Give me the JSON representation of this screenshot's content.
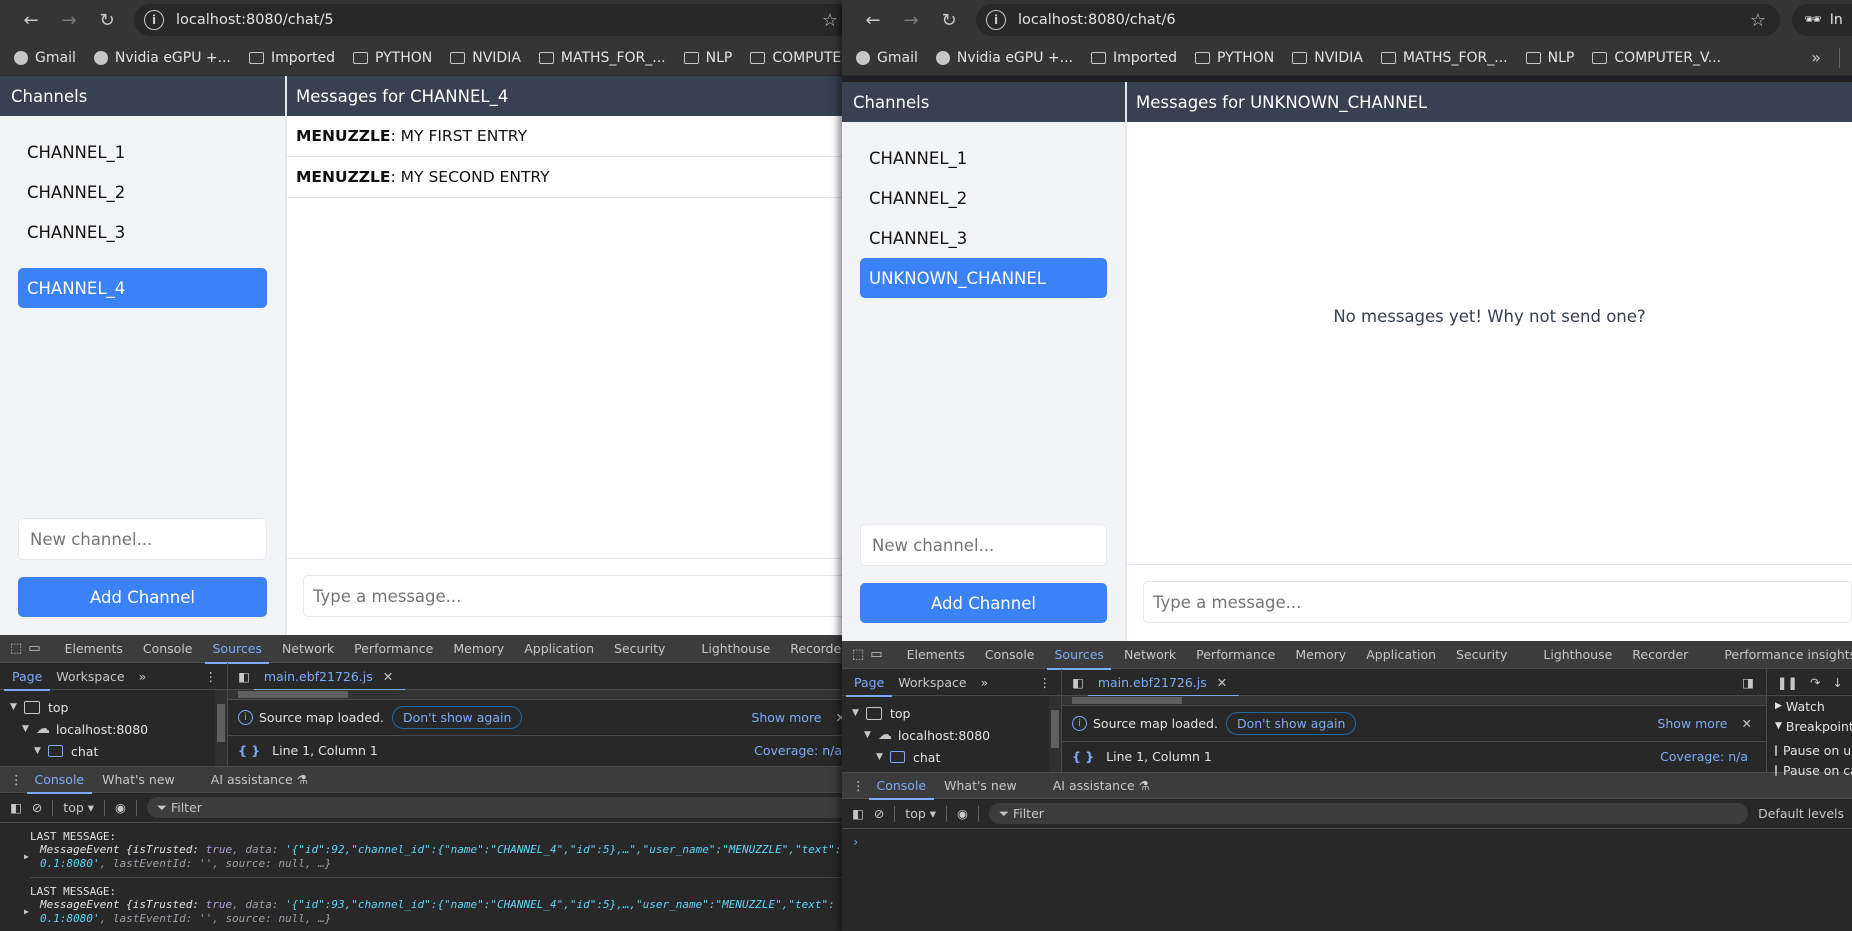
{
  "windows": [
    {
      "url": "localhost:8080/chat/5",
      "bookmarks": [
        "Gmail",
        "Nvidia eGPU +...",
        "Imported",
        "PYTHON",
        "NVIDIA",
        "MATHS_FOR_...",
        "NLP",
        "COMPUTER_V..."
      ],
      "app": {
        "sidebar_title": "Channels",
        "channels": [
          "CHANNEL_1",
          "CHANNEL_2",
          "CHANNEL_3",
          "CHANNEL_4"
        ],
        "active_channel": "CHANNEL_4",
        "new_channel_placeholder": "New channel...",
        "add_channel_label": "Add Channel",
        "messages_title": "Messages for CHANNEL_4",
        "messages": [
          {
            "user": "MENUZZLE",
            "text": "MY FIRST ENTRY"
          },
          {
            "user": "MENUZZLE",
            "text": "MY SECOND ENTRY"
          }
        ],
        "empty_text": "",
        "message_placeholder": "Type a message..."
      },
      "devtools": {
        "tabs": [
          "Elements",
          "Console",
          "Sources",
          "Network",
          "Performance",
          "Memory",
          "Application",
          "Security",
          "Lighthouse",
          "Recorder"
        ],
        "active_tab": "Sources",
        "nav_tabs": [
          "Page",
          "Workspace"
        ],
        "tree": [
          "top",
          "localhost:8080",
          "chat"
        ],
        "file_tab": "main.ebf21726.js",
        "info_text": "Source map loaded.",
        "dont_show": "Don't show again",
        "show_more": "Show more",
        "status_position": "Line 1, Column 1",
        "coverage": "Coverage: n/a",
        "drawer_tabs": [
          "Console",
          "What's new",
          "AI assistance"
        ],
        "context": "top",
        "filter_placeholder": "Filter",
        "logs": [
          {
            "label": "LAST MESSAGE:",
            "line1_pre": "MessageEvent {isTrusted: ",
            "line1_true": "true",
            "line1_mid": ", data: ",
            "line1_str": "'{\"id\":92,\"channel_id\":{\"name\":\"CHANNEL_4\",\"id\":5},…\",\"user_name\":\"MENUZZLE\",\"text\":",
            "line2_str": "0.1:8080'",
            "line2_rest": ", lastEventId: '', source: null, …}"
          },
          {
            "label": "LAST MESSAGE:",
            "line1_pre": "MessageEvent {isTrusted: ",
            "line1_true": "true",
            "line1_mid": ", data: ",
            "line1_str": "'{\"id\":93,\"channel_id\":{\"name\":\"CHANNEL_4\",\"id\":5},…,\"user_name\":\"MENUZZLE\",\"text\":",
            "line2_str": "0.1:8080'",
            "line2_rest": ", lastEventId: '', source: null, …}"
          }
        ]
      }
    },
    {
      "url": "localhost:8080/chat/6",
      "profile_label": "In",
      "bookmarks": [
        "Gmail",
        "Nvidia eGPU +...",
        "Imported",
        "PYTHON",
        "NVIDIA",
        "MATHS_FOR_...",
        "NLP",
        "COMPUTER_V..."
      ],
      "app": {
        "sidebar_title": "Channels",
        "channels": [
          "CHANNEL_1",
          "CHANNEL_2",
          "CHANNEL_3",
          "UNKNOWN_CHANNEL"
        ],
        "active_channel": "UNKNOWN_CHANNEL",
        "new_channel_placeholder": "New channel...",
        "add_channel_label": "Add Channel",
        "messages_title": "Messages for UNKNOWN_CHANNEL",
        "messages": [],
        "empty_text": "No messages yet! Why not send one?",
        "message_placeholder": "Type a message..."
      },
      "devtools": {
        "tabs": [
          "Elements",
          "Console",
          "Sources",
          "Network",
          "Performance",
          "Memory",
          "Application",
          "Security",
          "Lighthouse",
          "Recorder",
          "Performance insights"
        ],
        "active_tab": "Sources",
        "nav_tabs": [
          "Page",
          "Workspace"
        ],
        "tree": [
          "top",
          "localhost:8080",
          "chat"
        ],
        "file_tab": "main.ebf21726.js",
        "info_text": "Source map loaded.",
        "dont_show": "Don't show again",
        "show_more": "Show more",
        "status_position": "Line 1, Column 1",
        "coverage": "Coverage: n/a",
        "debugger": {
          "watch": "Watch",
          "breakpoints": "Breakpoints",
          "pause_uncaught": "Pause on uncaught exceptions",
          "pause_caught": "Pause on caught exceptions"
        },
        "drawer_tabs": [
          "Console",
          "What's new",
          "AI assistance"
        ],
        "context": "top",
        "filter_placeholder": "Filter",
        "levels": "Default levels",
        "logs": []
      }
    }
  ]
}
